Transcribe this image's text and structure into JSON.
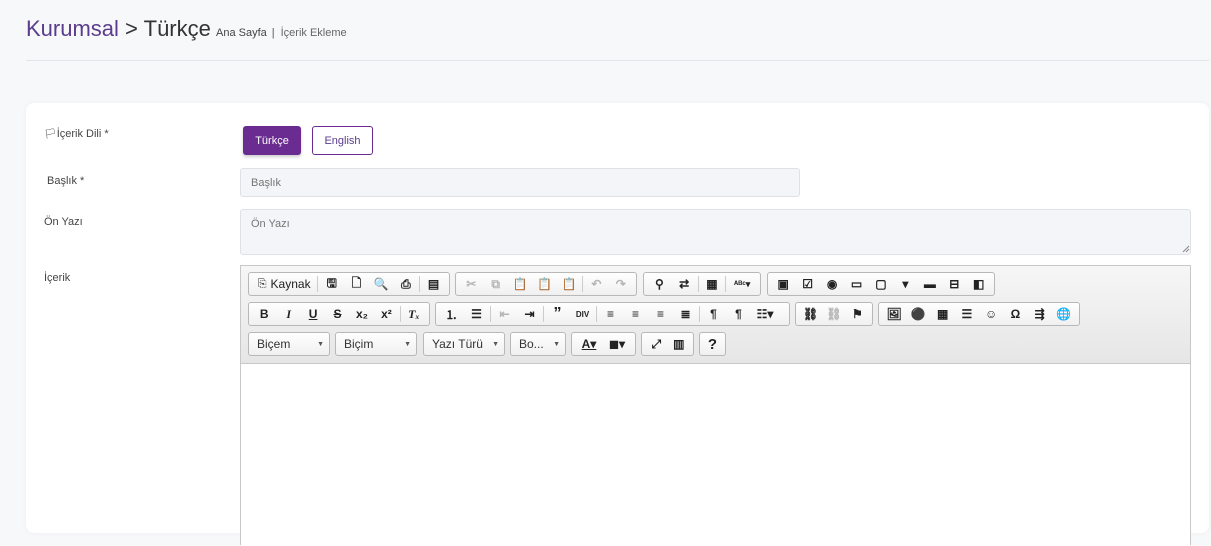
{
  "header": {
    "section": "Kurumsal",
    "separator": ">",
    "language": "Türkçe",
    "breadcrumb_home": "Ana Sayfa",
    "breadcrumb_current": "İçerik Ekleme"
  },
  "form": {
    "content_language_label": "İçerik Dili *",
    "lang_turkish": "Türkçe",
    "lang_english": "English",
    "title_label": "Başlık *",
    "title_placeholder": "Başlık",
    "intro_label": "Ön Yazı",
    "intro_placeholder": "Ön Yazı",
    "content_label": "İçerik"
  },
  "editor": {
    "source_label": "Kaynak",
    "format_label": "Biçem",
    "style_label": "Biçim",
    "font_label": "Yazı Türü",
    "size_label": "Bo...",
    "help_label": "?"
  },
  "colors": {
    "accent": "#6a2c91",
    "title": "#5b3c8c"
  }
}
